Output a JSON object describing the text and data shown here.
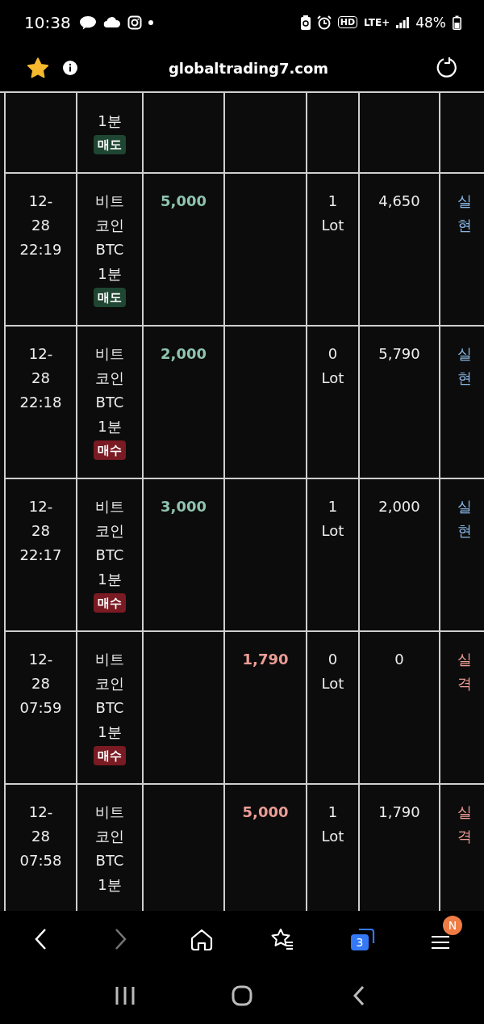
{
  "status_bar": {
    "time": "10:38",
    "hd_badge": "HD",
    "network": "LTE+",
    "battery": "48%"
  },
  "address_bar": {
    "url": "globaltrading7.com",
    "bookmarked": true
  },
  "partial_row": {
    "column_2": "1분",
    "side": {
      "label": "매도",
      "kind": "sell"
    }
  },
  "rows": [
    {
      "column_1": "12-\n28\n22:19",
      "column_2": "비트\n코인\nBTC\n1분",
      "side": {
        "label": "매도",
        "kind": "sell"
      },
      "column_3": "5,000",
      "column_5": "1\nLot",
      "column_6": "4,650",
      "column_7": {
        "text": "실현",
        "kind": "gain"
      }
    },
    {
      "column_1": "12-\n28\n22:18",
      "column_2": "비트\n코인\nBTC\n1분",
      "side": {
        "label": "매수",
        "kind": "buy"
      },
      "column_3": "2,000",
      "column_5": "0\nLot",
      "column_6": "5,790",
      "column_7": {
        "text": "실현",
        "kind": "gain"
      }
    },
    {
      "column_1": "12-\n28\n22:17",
      "column_2": "비트\n코인\nBTC\n1분",
      "side": {
        "label": "매수",
        "kind": "buy"
      },
      "column_3": "3,000",
      "column_5": "1\nLot",
      "column_6": "2,000",
      "column_7": {
        "text": "실현",
        "kind": "gain"
      }
    },
    {
      "column_1": "12-\n28\n07:59",
      "column_2": "비트\n코인\nBTC\n1분",
      "side": {
        "label": "매수",
        "kind": "buy"
      },
      "column_4": "1,790",
      "column_5": "0\nLot",
      "column_6": "0",
      "column_7": {
        "text": "실격",
        "kind": "loss"
      }
    },
    {
      "column_1": "12-\n28\n07:58",
      "column_2": "비트\n코인\nBTC\n1분",
      "column_4": "5,000",
      "column_5": "1\nLot",
      "column_6": "1,790",
      "column_7": {
        "text": "실격",
        "kind": "loss"
      }
    }
  ],
  "toolbar": [
    {
      "kind": "back",
      "disabled": false
    },
    {
      "kind": "forward",
      "disabled": true
    },
    {
      "kind": "home",
      "disabled": false
    },
    {
      "kind": "bookmarks",
      "disabled": false
    },
    {
      "kind": "tabs",
      "disabled": false,
      "count": "3"
    },
    {
      "kind": "menu",
      "disabled": false,
      "badge": "N"
    }
  ],
  "system_nav": [
    {
      "kind": "recents"
    },
    {
      "kind": "home"
    },
    {
      "kind": "back"
    }
  ]
}
